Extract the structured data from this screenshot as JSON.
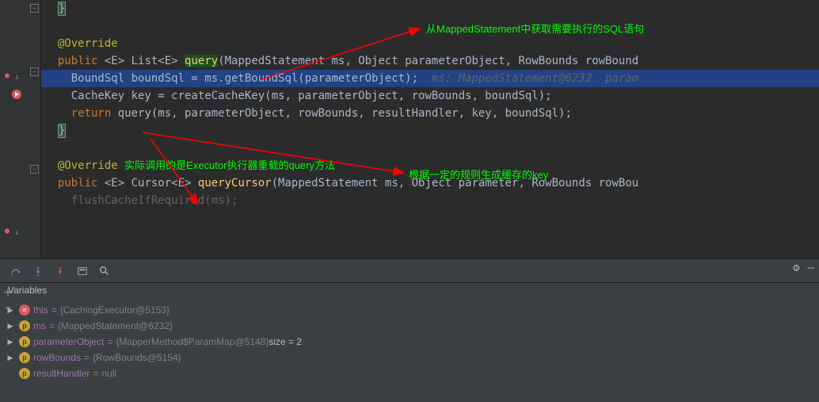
{
  "annotations": {
    "top": "从MappedStatement中获取需要执行的SQL语句",
    "mid": "根据一定的规则生成缓存的key",
    "bottom": "实际调用的是Executor执行器重载的query方法"
  },
  "code": {
    "override": "@Override",
    "l2_pub": "public",
    "l2_gen": "<E> List<E> ",
    "l2_meth": "query",
    "l2_args": "(MappedStatement ms, Object parameterObject, RowBounds rowBound",
    "l3_a": "BoundSql boundSql = ms.getBoundSql(parameterObject);",
    "l3_hint": "  ms: MappedStatement@6232  param",
    "l4": "CacheKey key = createCacheKey(ms, parameterObject, rowBounds, boundSql);",
    "l5_ret": "return",
    "l5_rest": " query(ms, parameterObject, rowBounds, resultHandler, key, boundSql);",
    "l6": "}",
    "l8_pub": "public",
    "l8_gen": "<E> Cursor<E> ",
    "l8_meth": "queryCursor",
    "l8_args": "(MappedStatement ms, Object parameter, RowBounds rowBou",
    "l9": "flushCacheIfRequired(ms);",
    "brace": "}"
  },
  "debug": {
    "header": "Variables",
    "vars": [
      {
        "badge": "red",
        "badgeChar": "≡",
        "name": "this",
        "val": "{CachingExecutor@5153}",
        "extra": ""
      },
      {
        "badge": "orange",
        "badgeChar": "p",
        "name": "ms",
        "val": "{MappedStatement@6232}",
        "extra": ""
      },
      {
        "badge": "orange",
        "badgeChar": "p",
        "name": "parameterObject",
        "val": "{MapperMethod$ParamMap@5148}",
        "extra": "  size = 2"
      },
      {
        "badge": "orange",
        "badgeChar": "p",
        "name": "rowBounds",
        "val": "{RowBounds@5154}",
        "extra": ""
      },
      {
        "badge": "orange",
        "badgeChar": "p",
        "name": "resultHandler",
        "val": "null",
        "extra": "",
        "noexpand": true
      }
    ]
  }
}
